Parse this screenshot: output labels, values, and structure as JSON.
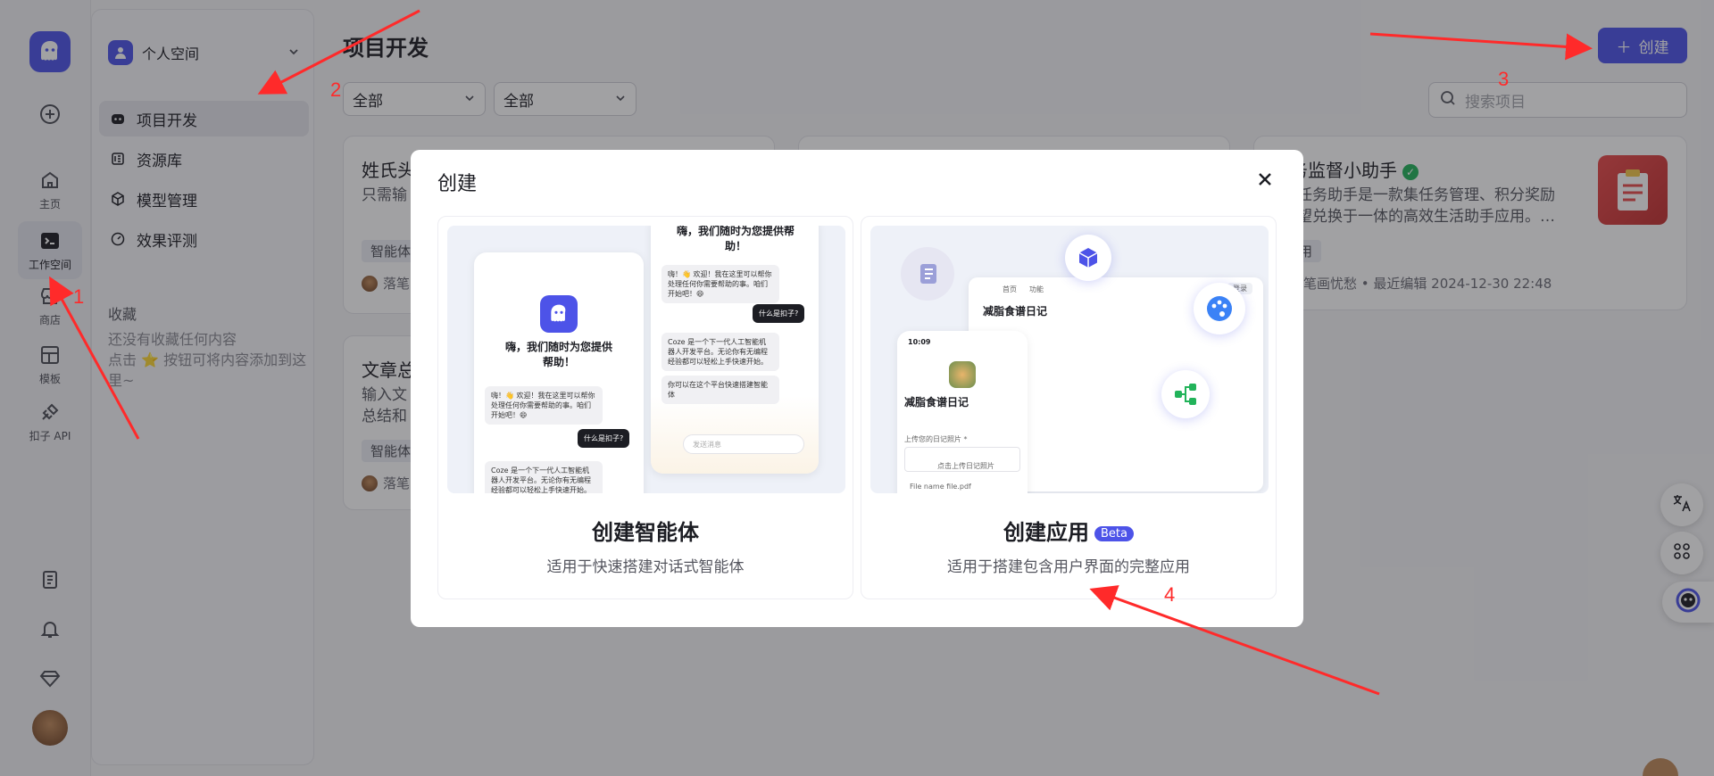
{
  "rail": {
    "items": [
      {
        "label": ""
      },
      {
        "label": "主页"
      },
      {
        "label": "工作空间"
      },
      {
        "label": "商店"
      },
      {
        "label": "模板"
      },
      {
        "label": "扣子 API"
      }
    ]
  },
  "sidebar": {
    "space_name": "个人空间",
    "nav": [
      {
        "label": "项目开发"
      },
      {
        "label": "资源库"
      },
      {
        "label": "模型管理"
      },
      {
        "label": "效果评测"
      }
    ],
    "favorites_title": "收藏",
    "favorites_empty_line1": "还没有收藏任何内容",
    "favorites_empty_line2": "点击 ⭐ 按钮可将内容添加到这里~"
  },
  "main": {
    "title": "项目开发",
    "filter1": "全部",
    "filter2": "全部",
    "create_label": "创建",
    "search_placeholder": "搜索项目",
    "cards": [
      {
        "title": "姓氏头",
        "desc": "只需输",
        "tag": "智能体",
        "author": "落笔"
      },
      {
        "title": "文章总",
        "desc_line1": "输入文",
        "desc_line2": "总结和",
        "tag": "智能体",
        "author": "落笔"
      },
      {
        "title": "务监督小助手",
        "desc_line1": "任务助手是一款集任务管理、积分奖励",
        "desc_line2": "望兑换于一体的高效生活助手应用。…",
        "tag": "用",
        "meta": "落笔画忧愁 • 最近编辑 2024-12-30 22:48"
      }
    ]
  },
  "modal": {
    "title": "创建",
    "options": [
      {
        "title": "创建智能体",
        "subtitle": "适用于快速搭建对话式智能体",
        "mock": {
          "greeting": "嗨，我们随时为您提供帮助！",
          "greeting_top": "嗨，我们随时为您提供帮助！",
          "bubble1": "嗨！👋 欢迎！我在这里可以帮你处理任何你需要帮助的事。咱们开始吧！😄",
          "question": "什么是扣子?",
          "answer": "Coze 是一个下一代人工智能机器人开发平台。无论你有无编程经验都可以轻松上手快速开始。",
          "answer2": "你可以在这个平台快速搭建智能体",
          "input_placeholder": "发送消息"
        }
      },
      {
        "title": "创建应用",
        "badge": "Beta",
        "subtitle": "适用于搭建包含用户界面的完整应用",
        "mock": {
          "app_title": "减脂食谱日记",
          "time": "10:09",
          "tab1": "首页",
          "tab2": "功能",
          "login": "登录",
          "upload_label": "上传您的日记照片 *",
          "upload_btn": "点击上传日记照片",
          "file": "File name file.pdf"
        }
      }
    ]
  },
  "annotations": [
    "1",
    "2",
    "3",
    "4"
  ],
  "colors": {
    "accent": "#4d53e8",
    "annotation": "#ff2a2a",
    "verified": "#21b35a"
  }
}
